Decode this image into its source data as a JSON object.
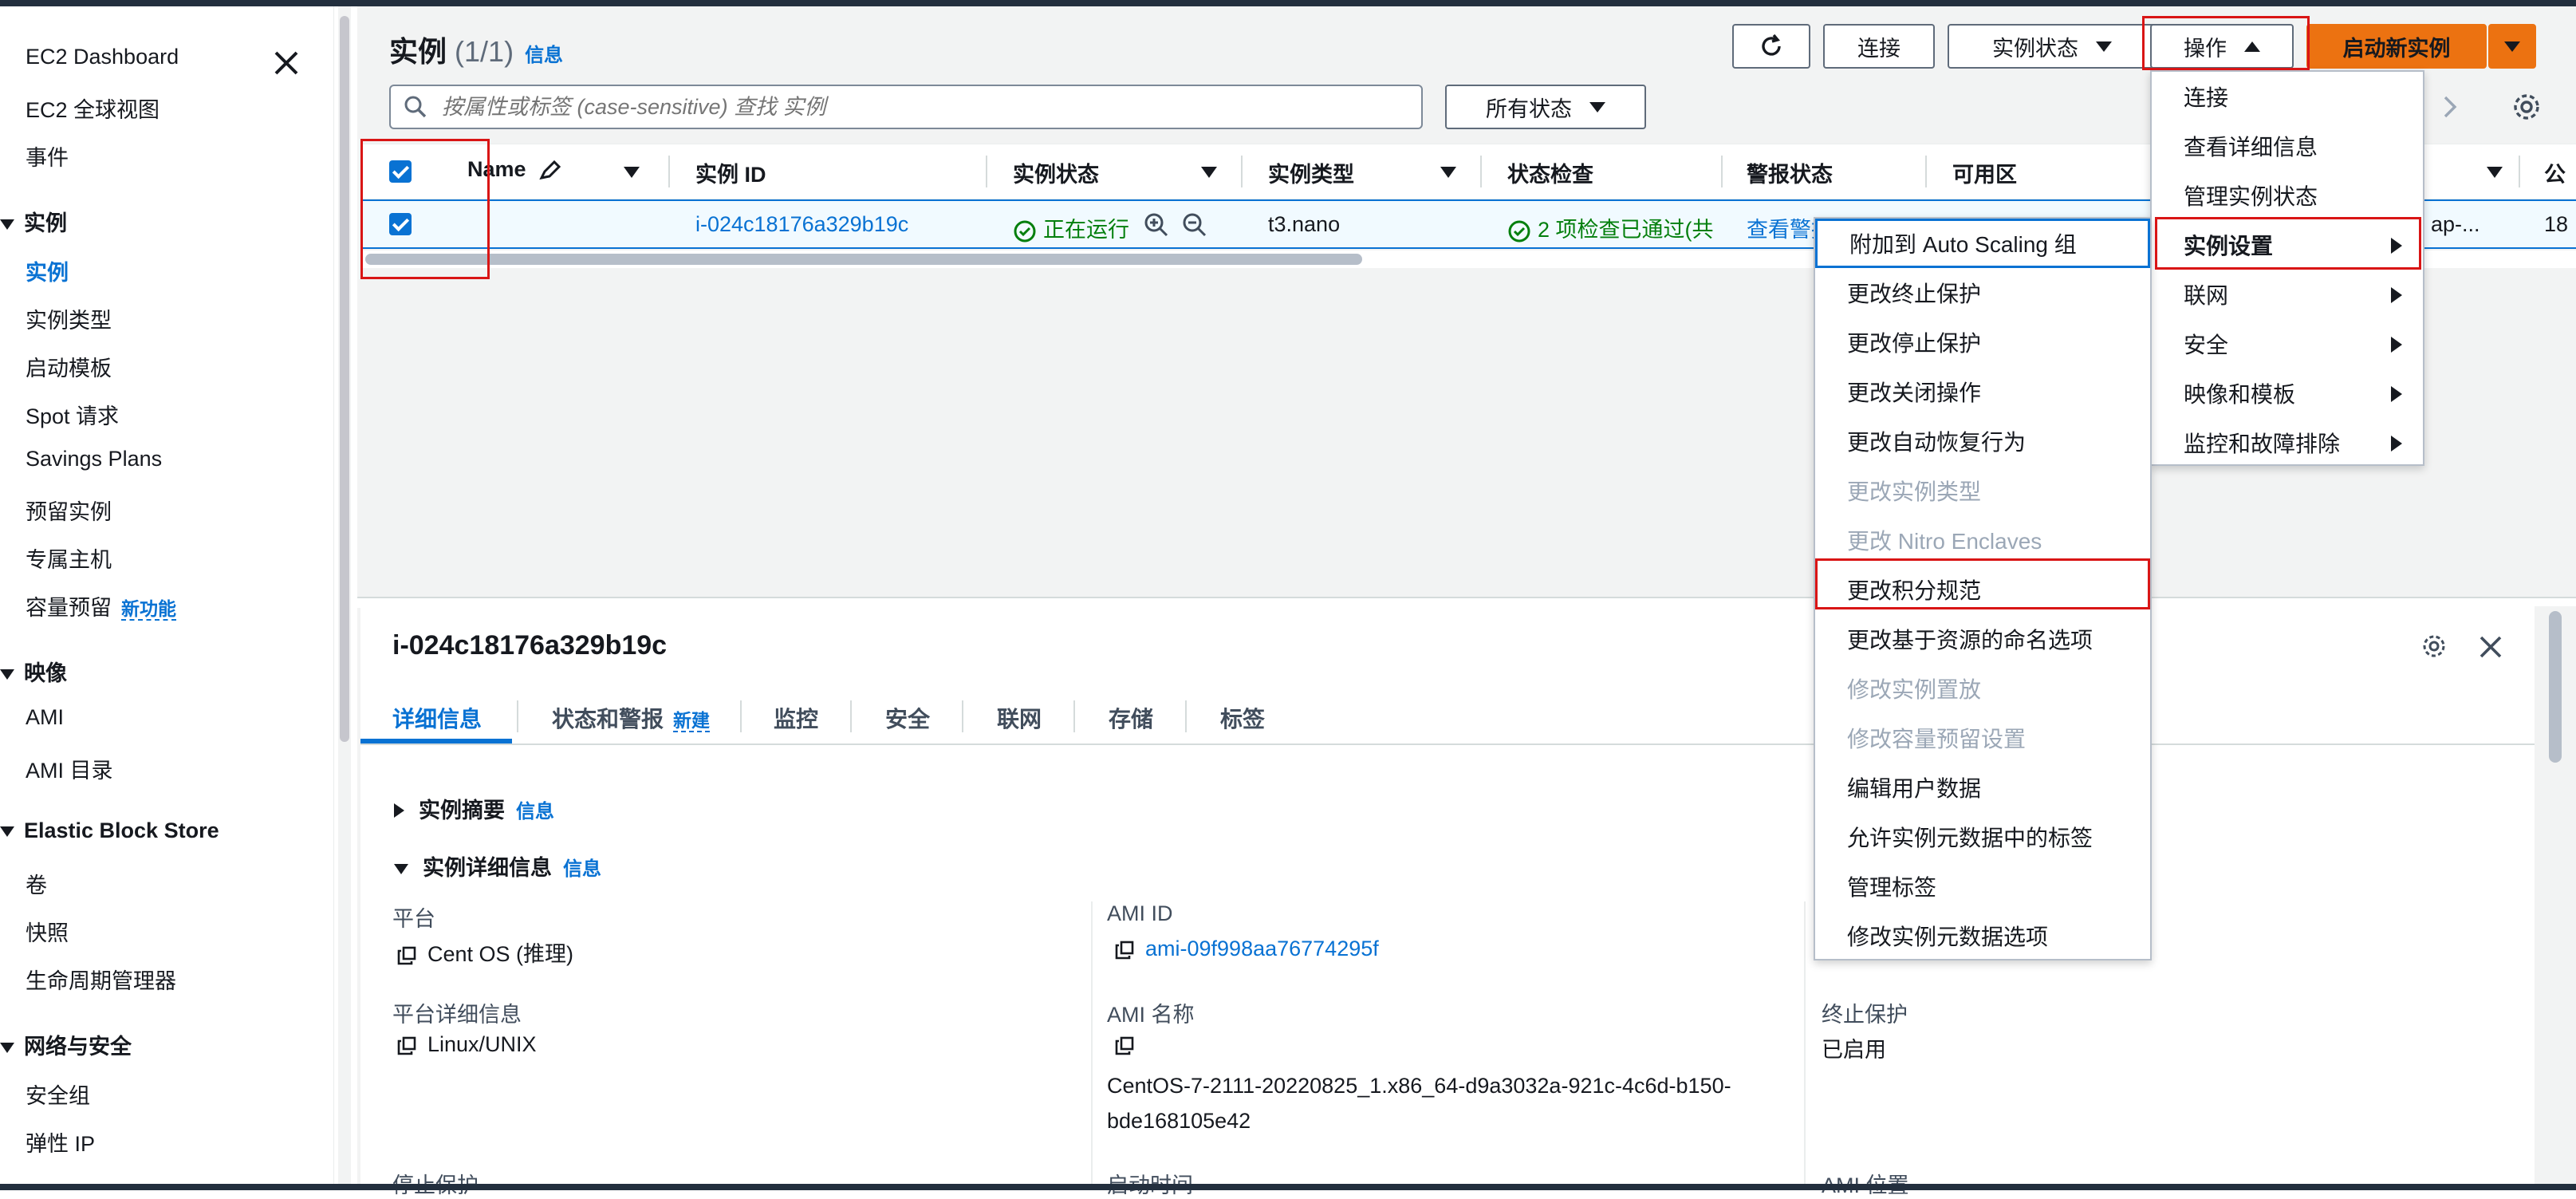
{
  "sidebar": {
    "items": {
      "dashboard": "EC2 Dashboard",
      "global_view": "EC2 全球视图",
      "events": "事件",
      "instances": "实例",
      "instance_types": "实例类型",
      "launch_templates": "启动模板",
      "spot_requests": "Spot 请求",
      "savings_plans": "Savings Plans",
      "reserved_instances": "预留实例",
      "dedicated_hosts": "专属主机",
      "capacity_reservations": "容量预留",
      "ami": "AMI",
      "ami_catalog": "AMI 目录",
      "volumes": "卷",
      "snapshots": "快照",
      "lifecycle_manager": "生命周期管理器",
      "security_groups": "安全组",
      "elastic_ip": "弹性 IP"
    },
    "sections": {
      "instances": "实例",
      "images": "映像",
      "ebs": "Elastic Block Store",
      "network_security": "网络与安全"
    },
    "new_badge": "新功能"
  },
  "header": {
    "title": "实例",
    "count": "(1/1)",
    "info": "信息",
    "connect": "连接",
    "instance_state": "实例状态",
    "actions": "操作",
    "launch": "启动新实例"
  },
  "search": {
    "placeholder": "按属性或标签 (case-sensitive) 查找 实例"
  },
  "filter": {
    "selected": "所有状态"
  },
  "table": {
    "columns": {
      "name": "Name",
      "instance_id": "实例 ID",
      "state": "实例状态",
      "type": "实例类型",
      "status_check": "状态检查",
      "alarm": "警报状态",
      "az": "可用区",
      "public": "公"
    },
    "row": {
      "instance_id": "i-024c18176a329b19c",
      "state": "正在运行",
      "type": "t3.nano",
      "status_check": "2 项检查已通过(共",
      "alarm": "查看警报",
      "az_partial": "ap-...",
      "public_partial": "18"
    }
  },
  "details": {
    "title": "i-024c18176a329b19c",
    "tabs": [
      "详细信息",
      "状态和警报",
      "监控",
      "安全",
      "联网",
      "存储",
      "标签"
    ],
    "tab_new": "新建",
    "summary": "实例摘要",
    "summary_info": "信息",
    "detail_section": "实例详细信息",
    "detail_info": "信息",
    "platform_label": "平台",
    "platform_value": "Cent OS (推理)",
    "platform_detail_label": "平台详细信息",
    "platform_detail_value": "Linux/UNIX",
    "stop_protection_label": "停止保护",
    "ami_id_label": "AMI ID",
    "ami_id_value": "ami-09f998aa76774295f",
    "ami_name_label": "AMI 名称",
    "ami_name_value_1": "CentOS-7-2111-20220825_1.x86_64-d9a3032a-921c-4c6d-b150-",
    "ami_name_value_2": "bde168105e42",
    "launch_time_label": "启动时间",
    "termination_label": "终止保护",
    "termination_value": "已启用",
    "ami_location_label": "AMI 位置"
  },
  "actions_menu": [
    {
      "label": "连接",
      "sub": false
    },
    {
      "label": "查看详细信息",
      "sub": false
    },
    {
      "label": "管理实例状态",
      "sub": false
    },
    {
      "label": "实例设置",
      "sub": true
    },
    {
      "label": "联网",
      "sub": true
    },
    {
      "label": "安全",
      "sub": true
    },
    {
      "label": "映像和模板",
      "sub": true
    },
    {
      "label": "监控和故障排除",
      "sub": true
    }
  ],
  "settings_menu": [
    {
      "label": "附加到 Auto Scaling 组",
      "disabled": false
    },
    {
      "label": "更改终止保护",
      "disabled": false
    },
    {
      "label": "更改停止保护",
      "disabled": false
    },
    {
      "label": "更改关闭操作",
      "disabled": false
    },
    {
      "label": "更改自动恢复行为",
      "disabled": false
    },
    {
      "label": "更改实例类型",
      "disabled": true
    },
    {
      "label": "更改 Nitro Enclaves",
      "disabled": true
    },
    {
      "label": "更改积分规范",
      "disabled": false
    },
    {
      "label": "更改基于资源的命名选项",
      "disabled": false
    },
    {
      "label": "修改实例置放",
      "disabled": true
    },
    {
      "label": "修改容量预留设置",
      "disabled": true
    },
    {
      "label": "编辑用户数据",
      "disabled": false
    },
    {
      "label": "允许实例元数据中的标签",
      "disabled": false
    },
    {
      "label": "管理标签",
      "disabled": false
    },
    {
      "label": "修改实例元数据选项",
      "disabled": false
    }
  ],
  "colors": {
    "accent": "#0972d3",
    "primary": "#ec7211",
    "running": "#037f0c",
    "highlight": "#d91515"
  }
}
